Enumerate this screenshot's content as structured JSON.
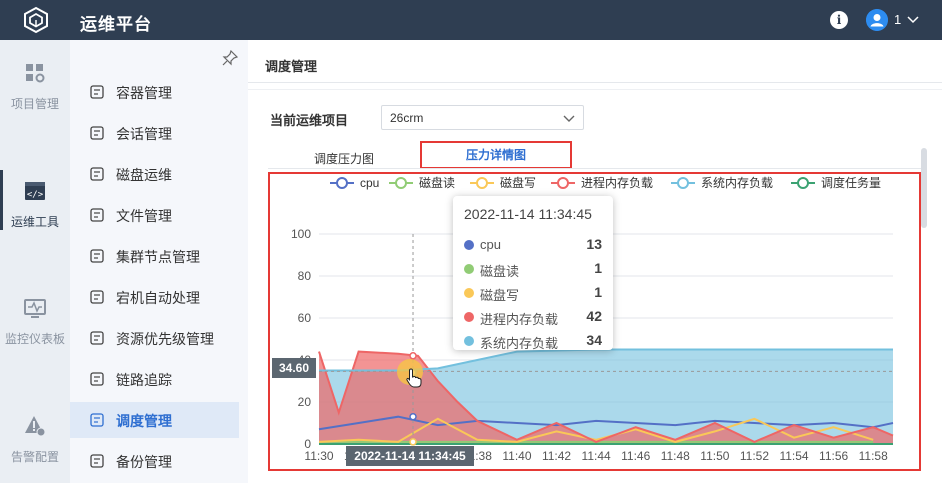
{
  "app": {
    "title": "运维平台",
    "user_count": "1"
  },
  "primary_nav": [
    {
      "label": "项目管理",
      "icon": "grid-icon"
    },
    {
      "label": "运维工具",
      "icon": "code-terminal-icon",
      "active": true
    },
    {
      "label": "监控仪表板",
      "icon": "monitor-pulse-icon"
    },
    {
      "label": "告警配置",
      "icon": "alert-gear-icon"
    }
  ],
  "secondary_nav": [
    {
      "label": "容器管理",
      "icon": "container-icon"
    },
    {
      "label": "会话管理",
      "icon": "session-icon"
    },
    {
      "label": "磁盘运维",
      "icon": "disk-icon"
    },
    {
      "label": "文件管理",
      "icon": "file-icon"
    },
    {
      "label": "集群节点管理",
      "icon": "sliders-icon"
    },
    {
      "label": "宕机自动处理",
      "icon": "auto-handle-icon"
    },
    {
      "label": "资源优先级管理",
      "icon": "priority-icon"
    },
    {
      "label": "链路追踪",
      "icon": "trace-icon"
    },
    {
      "label": "调度管理",
      "icon": "schedule-icon",
      "active": true
    },
    {
      "label": "备份管理",
      "icon": "backup-icon"
    }
  ],
  "main": {
    "breadcrumb": "调度管理",
    "project_label": "当前运维项目",
    "project_value": "26crm",
    "tabs": [
      "调度压力图",
      "压力详情图"
    ]
  },
  "tooltip": {
    "time": "2022-11-14 11:34:45",
    "rows": [
      {
        "name": "cpu",
        "value": "13",
        "color": "#5470c6"
      },
      {
        "name": "磁盘读",
        "value": "1",
        "color": "#91cc75"
      },
      {
        "name": "磁盘写",
        "value": "1",
        "color": "#fac858"
      },
      {
        "name": "进程内存负载",
        "value": "42",
        "color": "#ee6666"
      },
      {
        "name": "系统内存负载",
        "value": "34",
        "color": "#73c0de"
      }
    ]
  },
  "crosshair": {
    "y_label": "34.60",
    "x_label": "2022-11-14 11:34:45"
  },
  "chart_data": {
    "type": "line",
    "legend": [
      "cpu",
      "磁盘读",
      "磁盘写",
      "进程内存负载",
      "系统内存负载",
      "调度任务量"
    ],
    "legend_colors": [
      "#5470c6",
      "#91cc75",
      "#fac858",
      "#ee6666",
      "#73c0de",
      "#3ba272"
    ],
    "legend_position": "top",
    "grid": true,
    "ylim": [
      0,
      100
    ],
    "yticks": [
      0,
      20,
      40,
      60,
      80,
      100
    ],
    "x_range": [
      "11:30",
      "11:59"
    ],
    "xticks": [
      "11:30",
      "11:32",
      "11:34",
      "11:36",
      "11:38",
      "11:40",
      "11:42",
      "11:44",
      "11:46",
      "11:48",
      "11:50",
      "11:52",
      "11:54",
      "11:56",
      "11:58"
    ],
    "series": [
      {
        "name": "cpu",
        "x": [
          "11:30",
          "11:32",
          "11:34",
          "11:36",
          "11:38",
          "11:40",
          "11:42",
          "11:44",
          "11:46",
          "11:48",
          "11:50",
          "11:52",
          "11:54",
          "11:56",
          "11:58",
          "11:59"
        ],
        "values": [
          7,
          10,
          13,
          9,
          11,
          10,
          9,
          11,
          10,
          9,
          11,
          10,
          9,
          10,
          8,
          10
        ]
      },
      {
        "name": "磁盘读",
        "x": [
          "11:30",
          "11:34",
          "11:38",
          "11:42",
          "11:46",
          "11:50",
          "11:54",
          "11:58"
        ],
        "values": [
          1,
          1,
          1,
          1,
          1,
          1,
          1,
          1
        ]
      },
      {
        "name": "磁盘写",
        "x": [
          "11:30",
          "11:32",
          "11:34",
          "11:36",
          "11:38",
          "11:40",
          "11:42",
          "11:44",
          "11:46",
          "11:48",
          "11:50",
          "11:52",
          "11:54",
          "11:56",
          "11:58"
        ],
        "values": [
          1,
          2,
          1,
          12,
          2,
          1,
          6,
          2,
          7,
          1,
          6,
          12,
          3,
          8,
          2
        ]
      },
      {
        "name": "进程内存负载",
        "x": [
          "11:30",
          "11:31",
          "11:32",
          "11:34",
          "11:35",
          "11:36",
          "11:37",
          "11:38",
          "11:40",
          "11:42",
          "11:44",
          "11:46",
          "11:48",
          "11:50",
          "11:52",
          "11:54",
          "11:56",
          "11:58",
          "11:59"
        ],
        "values": [
          44,
          15,
          44,
          43,
          42,
          30,
          20,
          11,
          2,
          10,
          1,
          8,
          2,
          10,
          1,
          9,
          3,
          8,
          4
        ]
      },
      {
        "name": "系统内存负载",
        "x": [
          "11:30",
          "11:34",
          "11:36",
          "11:38",
          "11:40",
          "11:44",
          "11:50",
          "11:56",
          "11:59"
        ],
        "values": [
          35,
          35,
          36,
          40,
          44,
          45,
          45,
          45,
          45
        ]
      },
      {
        "name": "调度任务量",
        "x": [
          "11:30",
          "11:59"
        ],
        "values": [
          0,
          0
        ]
      }
    ]
  }
}
